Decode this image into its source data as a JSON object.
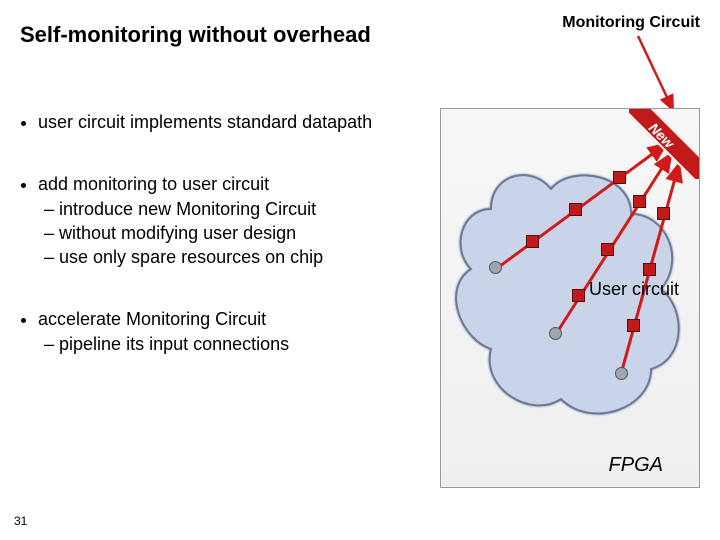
{
  "title": "Self-monitoring without overhead",
  "mc_label": "Monitoring Circuit",
  "bullets": [
    {
      "text": "user circuit implements standard datapath",
      "subs": []
    },
    {
      "text": "add monitoring to user circuit",
      "subs": [
        "introduce new Monitoring Circuit",
        "without modifying user design",
        "use only spare resources on chip"
      ]
    },
    {
      "text": "accelerate Monitoring Circuit",
      "subs": [
        "pipeline its input connections"
      ]
    }
  ],
  "diagram": {
    "fpga_label": "FPGA",
    "user_label": "User circuit",
    "new_banner": "New"
  },
  "slide_number": "31"
}
